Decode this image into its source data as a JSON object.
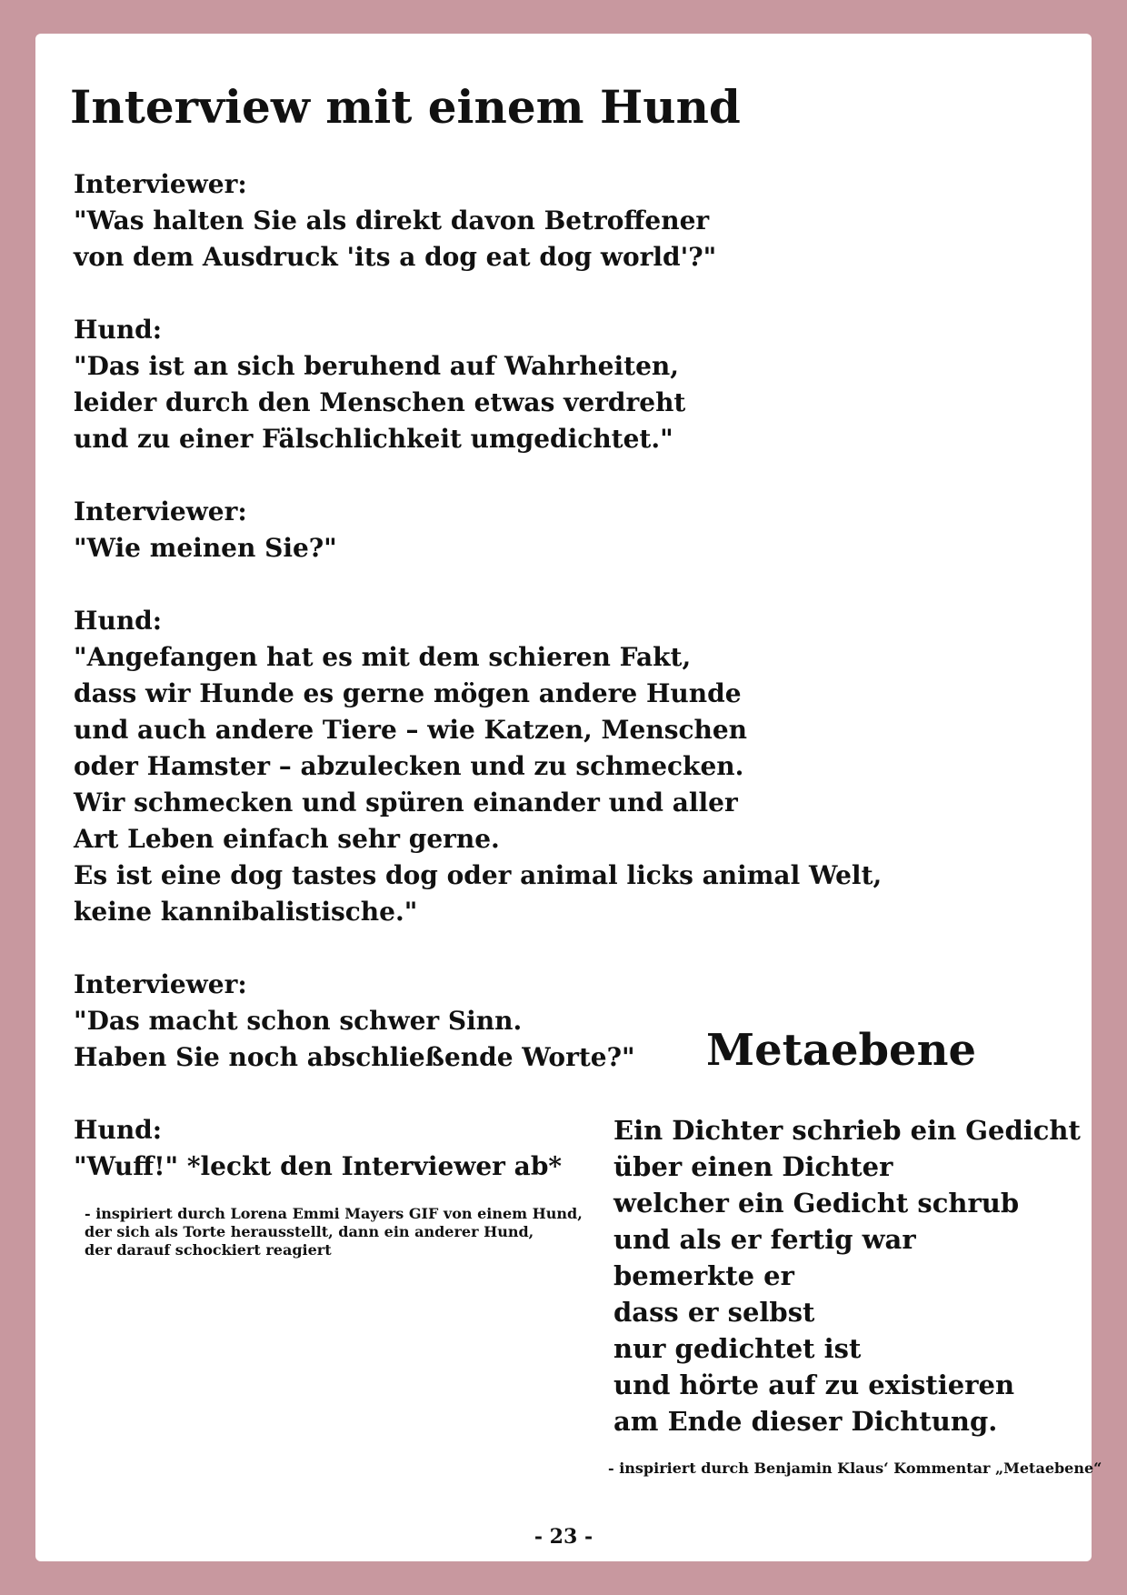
{
  "title": "Interview mit einem Hund",
  "interview": [
    {
      "speaker": "Interviewer:",
      "lines": [
        "\"Was halten Sie als direkt davon Betroffener",
        "von dem Ausdruck 'its a dog eat dog world'?\""
      ]
    },
    {
      "speaker": "Hund:",
      "lines": [
        "\"Das ist an sich beruhend auf Wahrheiten,",
        "leider durch den Menschen etwas verdreht",
        "und zu einer Fälschlichkeit umgedichtet.\""
      ]
    },
    {
      "speaker": "Interviewer:",
      "lines": [
        "\"Wie meinen Sie?\""
      ]
    },
    {
      "speaker": "Hund:",
      "lines": [
        "\"Angefangen hat es mit dem schieren Fakt,",
        "dass wir Hunde es gerne mögen andere Hunde",
        "und auch andere Tiere – wie Katzen, Menschen",
        "oder Hamster – abzulecken und zu schmecken.",
        "Wir schmecken und spüren einander und aller",
        "Art Leben einfach sehr gerne.",
        "Es ist eine dog tastes dog oder animal licks animal Welt,",
        "keine kannibalistische.\""
      ]
    },
    {
      "speaker": "Interviewer:",
      "lines": [
        "\"Das macht schon schwer Sinn.",
        "Haben Sie noch abschließende Worte?\""
      ]
    },
    {
      "speaker": "Hund:",
      "lines": [
        "\"Wuff!\" *leckt den Interviewer ab*"
      ]
    }
  ],
  "interview_credit": [
    "- inspiriert durch Lorena Emmi Mayers GIF von einem Hund,",
    "der sich als Torte herausstellt, dann ein anderer Hund,",
    "der darauf schockiert reagiert"
  ],
  "meta_title": "Metaebene",
  "poem": [
    "Ein Dichter schrieb ein Gedicht",
    "über einen Dichter",
    "welcher ein Gedicht schrub",
    "und als er fertig war",
    "bemerkte er",
    "dass er selbst",
    "nur gedichtet ist",
    "und hörte auf zu existieren",
    "am Ende dieser Dichtung."
  ],
  "poem_credit": "- inspiriert durch Benjamin Klaus‘ Kommentar „Metaebene“",
  "page_number": "- 23 -"
}
